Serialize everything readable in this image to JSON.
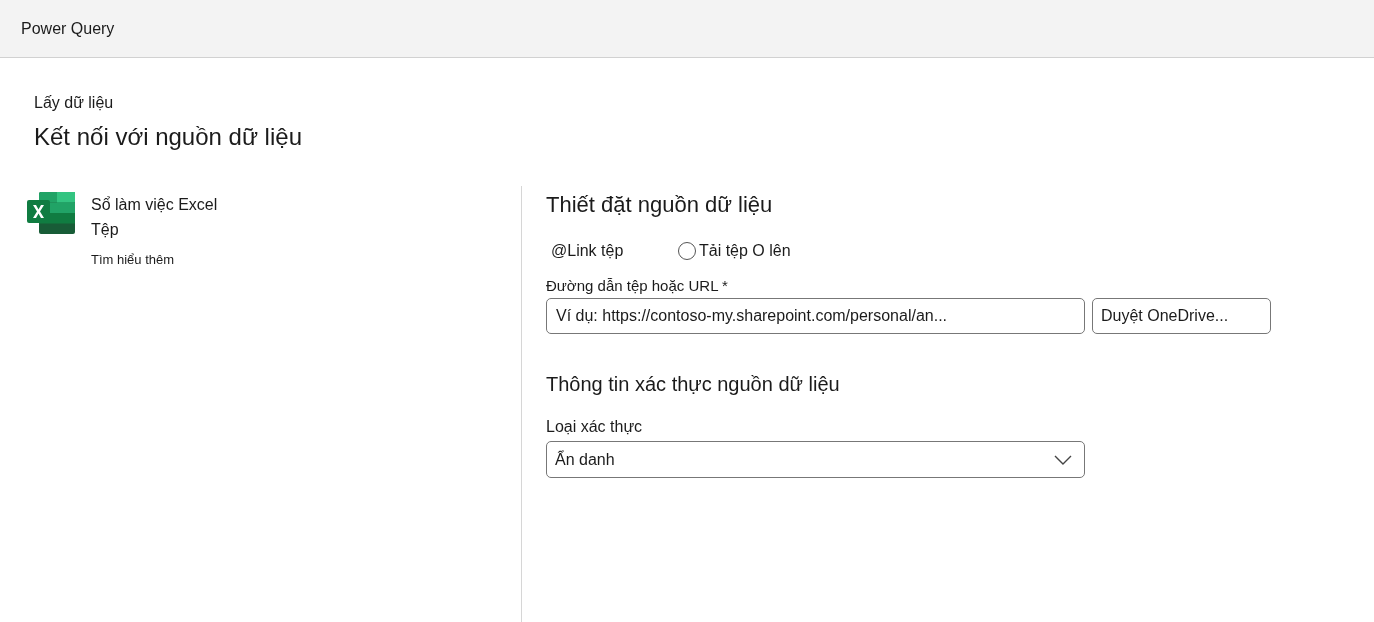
{
  "app_bar": {
    "title": "Power Query"
  },
  "page": {
    "breadcrumb": "Lấy dữ liệu",
    "title": "Kết nối với nguồn dữ liệu"
  },
  "connector": {
    "name": "Sổ làm việc Excel",
    "category": "Tệp",
    "link": "Tìm hiểu thêm"
  },
  "settings": {
    "heading": "Thiết đặt nguồn dữ liệu",
    "options": [
      {
        "kind": "label",
        "label": "@Link tệp"
      },
      {
        "kind": "radio",
        "label": "Tải tệp O lên",
        "checked": false
      }
    ],
    "path_field": {
      "label": "Đường dẫn tệp hoặc URL *",
      "placeholder": "Ví dụ: https://contoso-my.sharepoint.com/personal/an..."
    },
    "browse_button": "Duyệt OneDrive..."
  },
  "credentials": {
    "heading": "Thông tin xác thực nguồn dữ liệu",
    "auth_field": {
      "label": "Loại xác thực",
      "value": "Ẩn danh"
    }
  }
}
